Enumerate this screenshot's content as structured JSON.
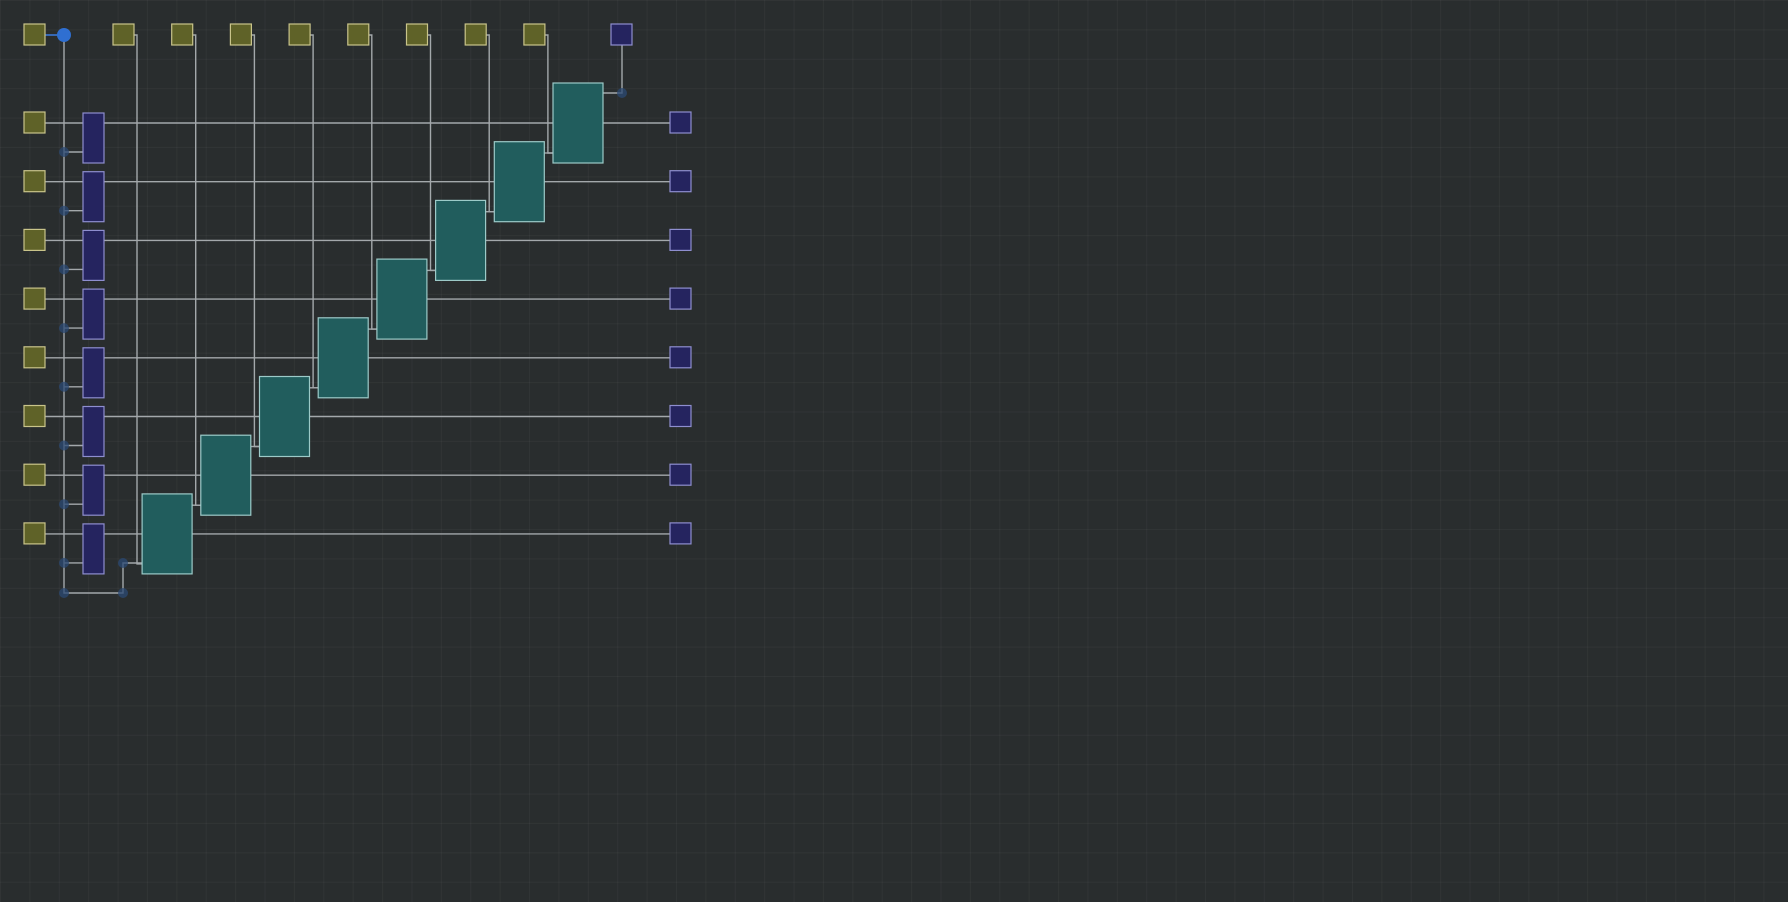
{
  "colors": {
    "background": "#292d2e",
    "wire": "#a3a8ab",
    "wire_active": "#3b7de0",
    "input_pin_fill": "#5f6228",
    "input_pin_stroke": "#c9c48a",
    "output_pin_fill": "#25245f",
    "output_pin_stroke": "#8e8ecf",
    "gate_fill": "#215d5d",
    "gate_stroke": "#9ccac8",
    "flipflop_fill": "#25245f",
    "flipflop_stroke": "#8e8ecf",
    "junction": "#2b4a74"
  },
  "components": {
    "top_input_pins": 9,
    "left_input_pins": 8,
    "right_output_pins": 8,
    "top_output_pins": 1,
    "adder_cells": 8,
    "side_modules": 8
  }
}
